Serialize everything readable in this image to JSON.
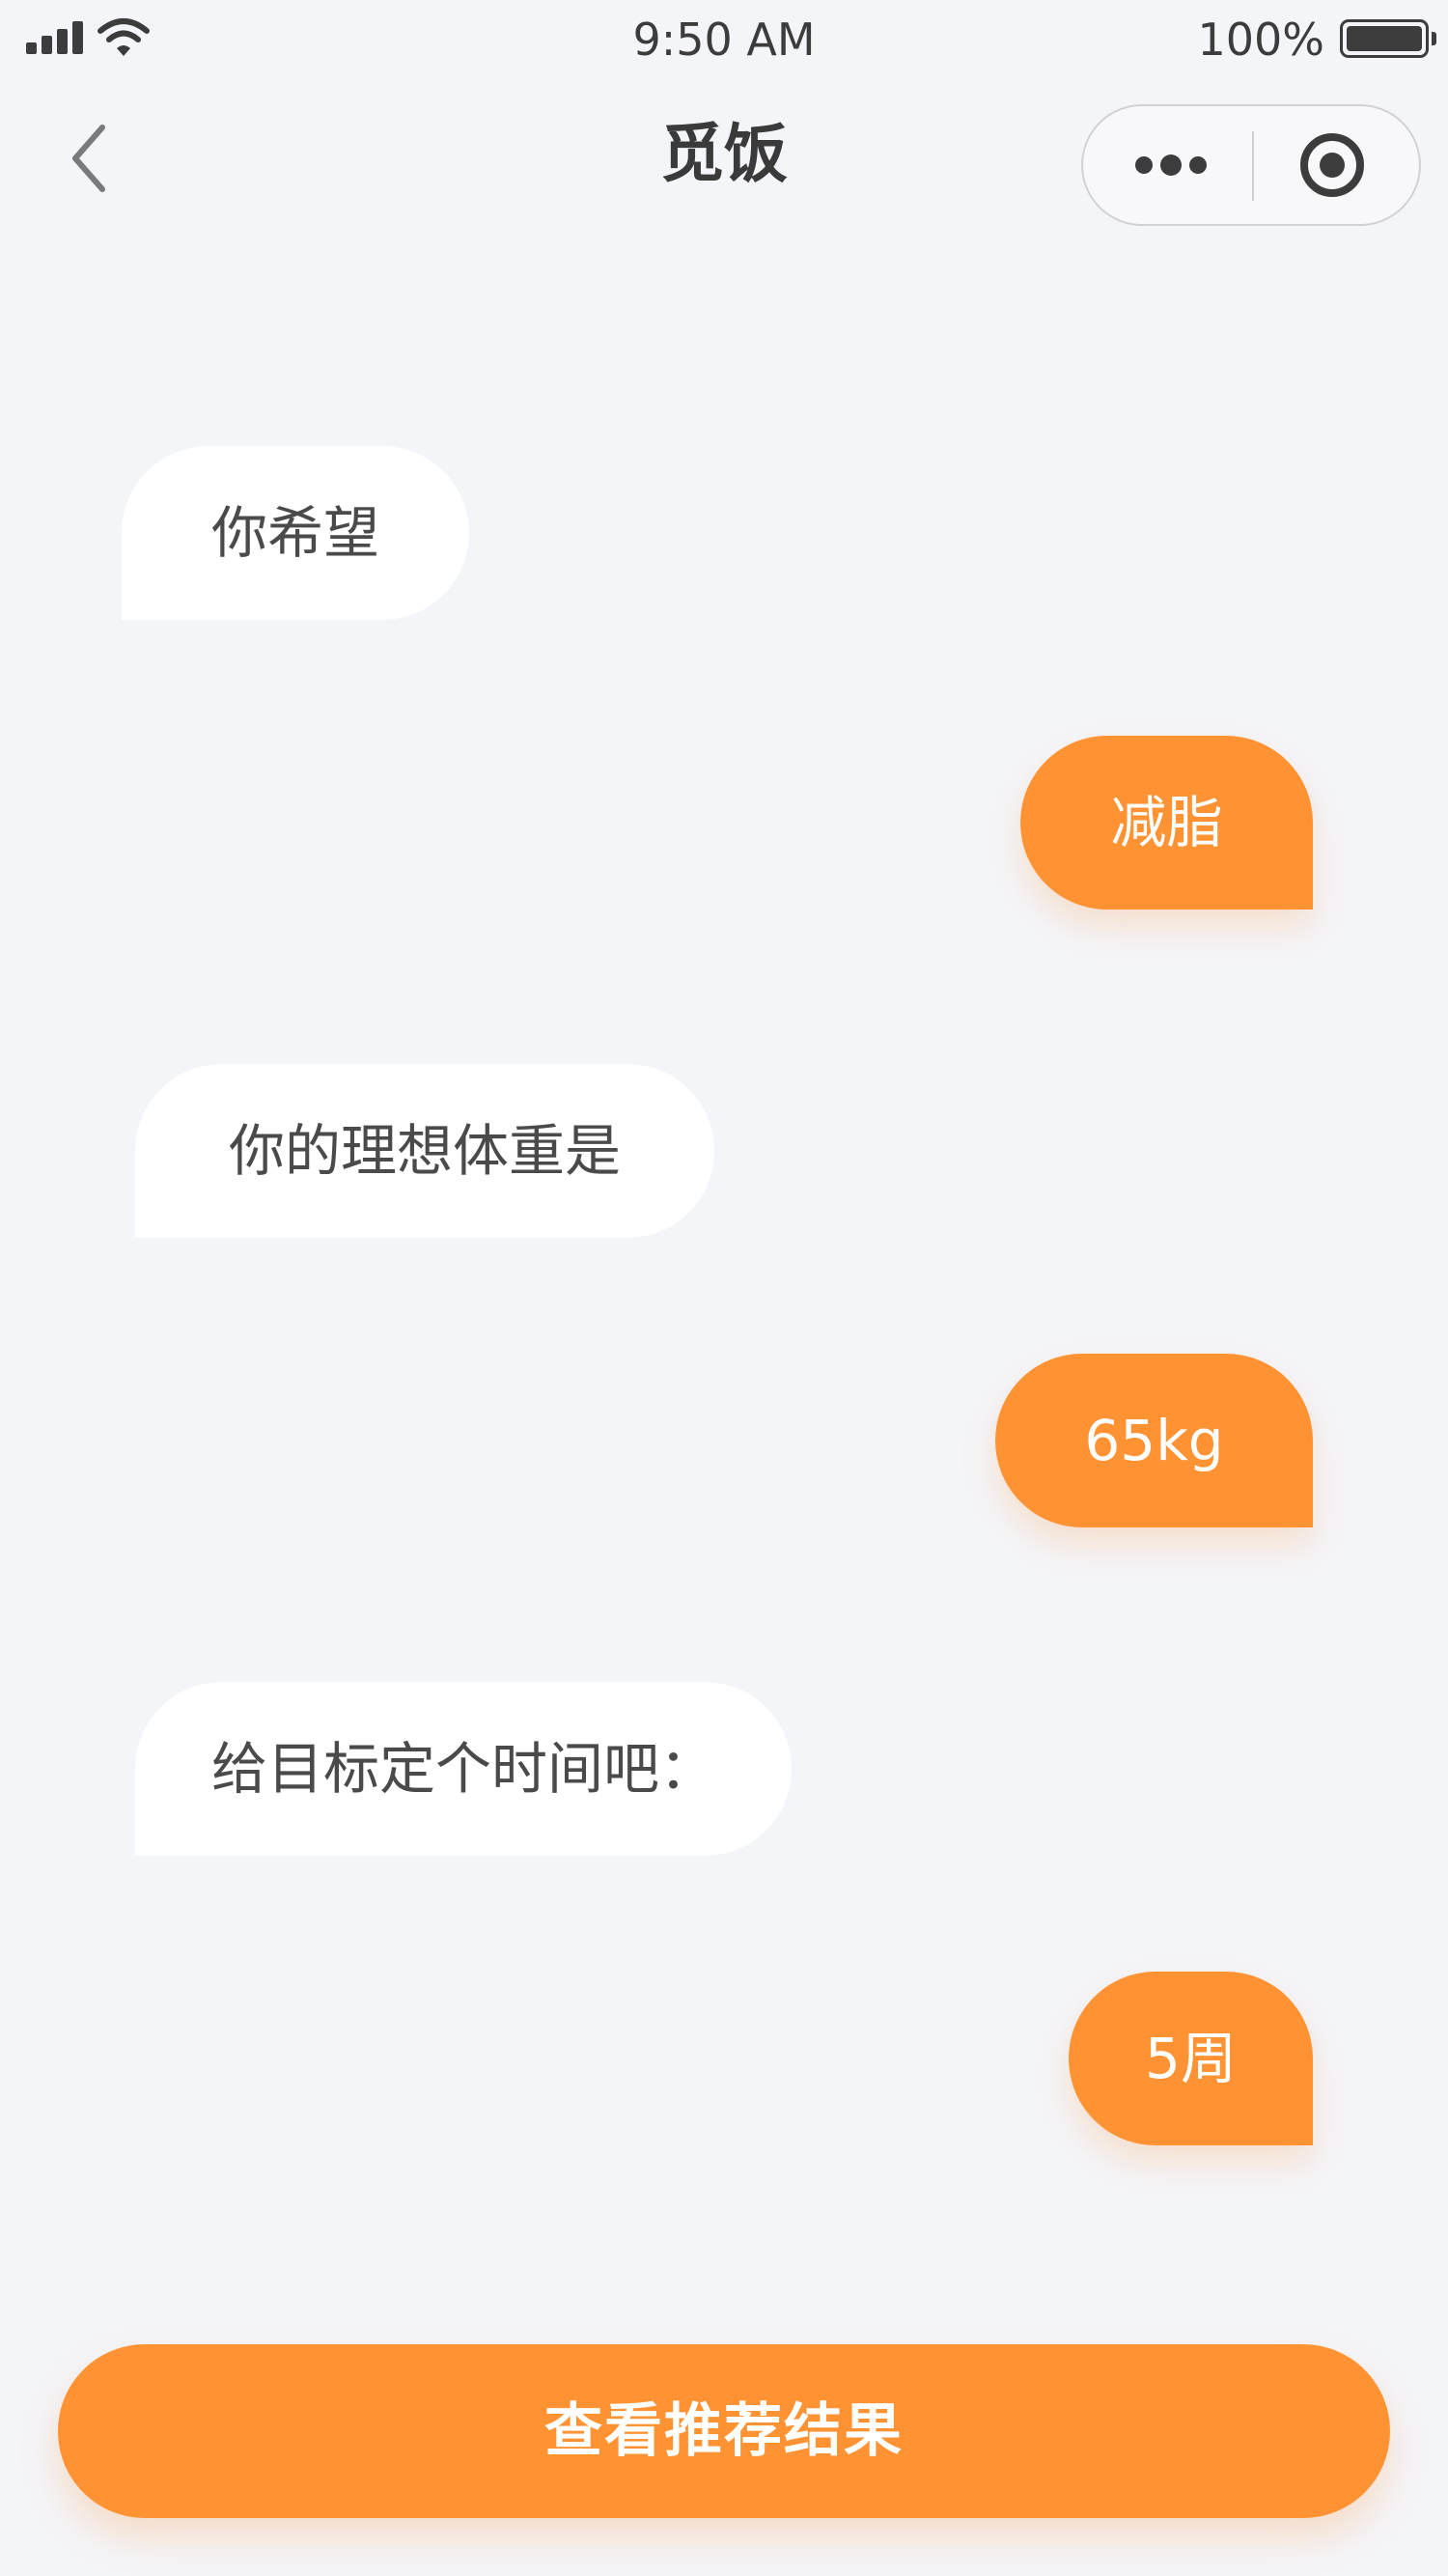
{
  "status_bar": {
    "time": "9:50 AM",
    "battery": "100%"
  },
  "nav": {
    "title": "觅饭"
  },
  "chat": {
    "messages": [
      {
        "role": "bot",
        "text": "你希望"
      },
      {
        "role": "user",
        "text": "减脂"
      },
      {
        "role": "bot",
        "text": "你的理想体重是"
      },
      {
        "role": "user",
        "text": "65kg"
      },
      {
        "role": "bot",
        "text": "给目标定个时间吧："
      },
      {
        "role": "user",
        "text": "5周"
      }
    ]
  },
  "actions": {
    "view_results_label": "查看推荐结果"
  },
  "colors": {
    "accent": "#ff9233",
    "background": "#f4f5f9",
    "bot_bubble": "#ffffff",
    "text": "#4a4a4a"
  }
}
